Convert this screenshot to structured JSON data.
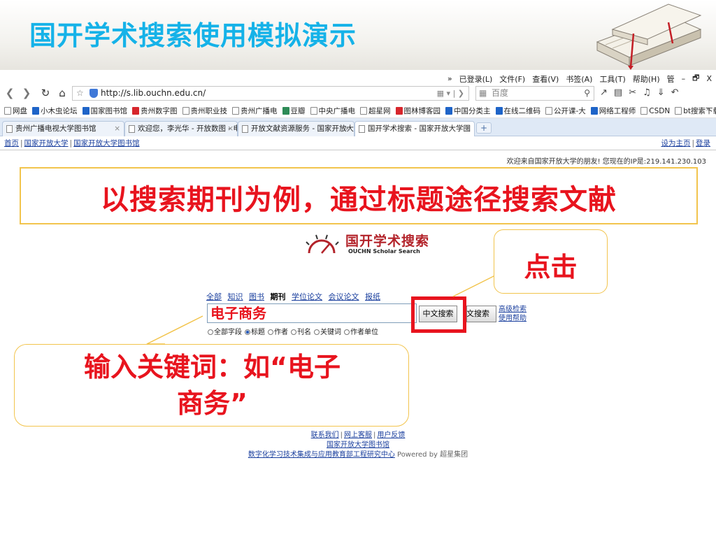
{
  "slide": {
    "title": "国开学术搜索使用模拟演示"
  },
  "browser": {
    "menubar": [
      "»",
      "已登录(L)",
      "文件(F)",
      "查看(V)",
      "书签(A)",
      "工具(T)",
      "帮助(H)",
      "管",
      "–",
      "🗗",
      "X"
    ],
    "url": "http://s.lib.ouchn.edu.cn/",
    "search_placeholder": "百度",
    "bookmarks": [
      {
        "label": "网盘",
        "icon": "folder-icon"
      },
      {
        "label": "小木虫论坛",
        "icon": "site-icon"
      },
      {
        "label": "国家图书馆",
        "icon": "site-icon"
      },
      {
        "label": "贵州数字图",
        "icon": "site-icon"
      },
      {
        "label": "贵州职业技",
        "icon": "page-icon"
      },
      {
        "label": "贵州广播电",
        "icon": "page-icon"
      },
      {
        "label": "豆瓣",
        "icon": "douban-icon"
      },
      {
        "label": "中央广播电",
        "icon": "page-icon"
      },
      {
        "label": "超星网",
        "icon": "page-icon"
      },
      {
        "label": "图林博客园",
        "icon": "site-icon"
      },
      {
        "label": "中国分类主",
        "icon": "site-icon"
      },
      {
        "label": "在线二维码",
        "icon": "site-icon"
      },
      {
        "label": "公开课-大",
        "icon": "page-icon"
      },
      {
        "label": "网络工程师",
        "icon": "site-icon"
      },
      {
        "label": "CSDN",
        "icon": "page-icon"
      },
      {
        "label": "bt搜索下载",
        "icon": "folder-icon"
      }
    ],
    "bookmarks_more": "»",
    "tabs": [
      {
        "label": "贵州广播电视大学图书馆"
      },
      {
        "label": "欢迎您，李光华 - 开放数图 - 电"
      },
      {
        "label": "开放文献资源服务 - 国家开放大"
      },
      {
        "label": "国开学术搜索 - 国家开放大学图"
      }
    ],
    "tab_new": "+"
  },
  "linkbar": {
    "left": [
      "首页",
      "国家开放大学",
      "国家开放大学图书馆"
    ],
    "right": [
      "设为主页",
      "登录"
    ]
  },
  "page": {
    "welcome": "欢迎来自国家开放大学的朋友! 您现在的IP是:219.141.230.103",
    "logo_cn": "国开学术搜索",
    "logo_en": "OUCHN Scholar Search",
    "categories": [
      {
        "label": "全部",
        "current": false
      },
      {
        "label": "知识",
        "current": false
      },
      {
        "label": "图书",
        "current": false
      },
      {
        "label": "期刊",
        "current": true
      },
      {
        "label": "学位论文",
        "current": false
      },
      {
        "label": "会议论文",
        "current": false
      },
      {
        "label": "报纸",
        "current": false
      }
    ],
    "search_value": "电子商务",
    "cn_search_button": "中文搜索",
    "fw_search_button": "外文搜索",
    "advanced_search": "高级检索",
    "help": "使用帮助",
    "fields": [
      {
        "label": "全部字段",
        "checked": false
      },
      {
        "label": "标题",
        "checked": true
      },
      {
        "label": "作者",
        "checked": false
      },
      {
        "label": "刊名",
        "checked": false
      },
      {
        "label": "关键词",
        "checked": false
      },
      {
        "label": "作者单位",
        "checked": false
      }
    ],
    "footer": {
      "links": [
        "联系我们",
        "网上客服",
        "用户反馈"
      ],
      "library": "国家开放大学图书馆",
      "center": "数字化学习技术集成与应用教育部工程研究中心",
      "powered": "Powered by 超星集团"
    }
  },
  "callouts": {
    "main": "以搜索期刊为例，通过标题途径搜索文献",
    "click": "点击",
    "keyword_line1": "输入关键词：如“电子",
    "keyword_line2": "商务”"
  },
  "colors": {
    "title_blue": "#15b2e8",
    "callout_red": "#e8141e",
    "callout_border": "#f2c44d",
    "link_blue": "#1a3f9e"
  }
}
